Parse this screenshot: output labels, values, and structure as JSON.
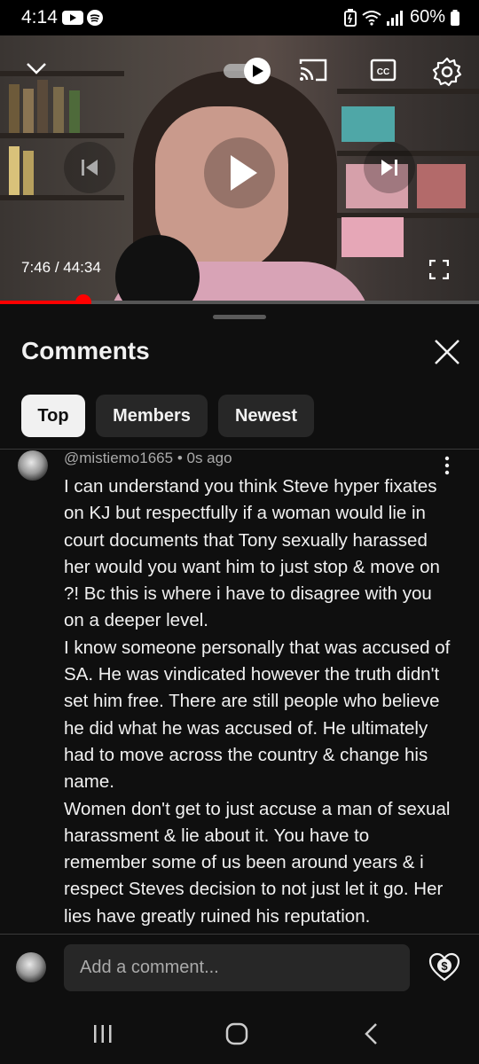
{
  "status_bar": {
    "time": "4:14",
    "battery": "60%",
    "icons": [
      "youtube-icon",
      "spotify-icon",
      "battery-saver-icon",
      "wifi-icon",
      "signal-icon",
      "battery-icon"
    ]
  },
  "player": {
    "time_current": "7:46",
    "time_total": "44:34",
    "time_separator": " / ",
    "progress_fraction": 0.174,
    "accent_color": "#ff0000",
    "controls": [
      "minimize-chevron-icon",
      "autoplay-toggle",
      "cast-icon",
      "captions-icon",
      "settings-gear-icon",
      "previous-icon",
      "play-icon",
      "next-icon",
      "fullscreen-icon"
    ]
  },
  "comments": {
    "title": "Comments",
    "filters": [
      "Top",
      "Members",
      "Newest"
    ],
    "active_filter": "Top",
    "items": [
      {
        "author": "@mistiemo1665",
        "separator": " • ",
        "time": "0s ago",
        "paragraphs": [
          "I can understand you think Steve hyper fixates on KJ but respectfully if a woman would lie in court documents that Tony sexually harassed her would you want him to just stop & move on ?! Bc this is where i have to disagree with you on a deeper level.",
          "I know someone personally that was accused of SA. He was vindicated however the truth didn't set him free. There are still people who believe he did what he was accused of. He ultimately had to move across the country & change his name.",
          "Women don't get to just accuse a man of sexual harassment & lie about it. You have to remember some of us been around years & i respect Steves decision to not just let it go. Her lies have greatly ruined his reputation."
        ]
      }
    ],
    "add_comment_placeholder": "Add a comment..."
  },
  "nav_bar": [
    "recent-apps-icon",
    "home-icon",
    "back-icon"
  ]
}
